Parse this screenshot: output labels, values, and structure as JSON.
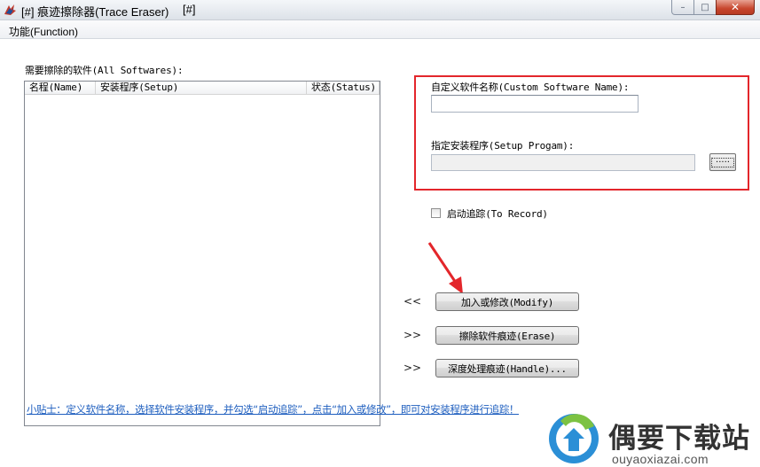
{
  "window": {
    "title": "[#] 痕迹擦除器(Trace Eraser)",
    "title_suffix": "[#]",
    "controls": {
      "minimize": "–",
      "maximize": "□",
      "close": "✕"
    }
  },
  "menu": {
    "function_label": "功能(Function)"
  },
  "list": {
    "label": "需要擦除的软件(All Softwares):",
    "columns": [
      "名程(Name)",
      "安装程序(Setup)",
      "状态(Status)"
    ]
  },
  "custom": {
    "name_label": "自定义软件名称(Custom Software Name):",
    "name_value": "",
    "setup_label": "指定安装程序(Setup Progam):",
    "setup_value": "",
    "browse_label": "....."
  },
  "record": {
    "label": "启动追踪(To Record)",
    "checked": false
  },
  "actions": {
    "modify": {
      "arrow": "<<",
      "label": "加入或修改(Modify)"
    },
    "erase": {
      "arrow": ">>",
      "label": "擦除软件痕迹(Erase)"
    },
    "handle": {
      "arrow": ">>",
      "label": "深度处理痕迹(Handle)..."
    }
  },
  "tip": "小贴士：定义软件名称，选择软件安装程序，并勾选“启动追踪”，点击“加入或修改”，即可对安装程序进行追踪！",
  "watermark": {
    "brand": "偶要下载站",
    "url": "ouyaoxiazai.com"
  },
  "colors": {
    "highlight_box": "#e3262b",
    "tip_link": "#1f5fbf"
  }
}
